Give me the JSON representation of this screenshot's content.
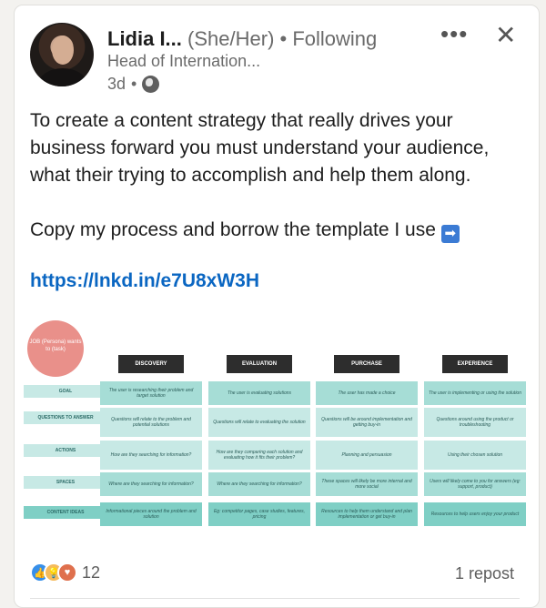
{
  "author": {
    "name": "Lidia I...",
    "pronouns": "(She/Her)",
    "separator": "•",
    "following": "Following",
    "headline": "Head of Internation...",
    "age": "3d",
    "visibility_icon": "globe-icon"
  },
  "actions": {
    "more_label": "•••",
    "close_label": "✕"
  },
  "post": {
    "paragraph1": "To create a content strategy that really drives your business forward you must understand your audience, what their trying to accomplish and help them along.",
    "paragraph2": "Copy my process and borrow the template I use",
    "arrow": "➡",
    "link": "https://lnkd.in/e7U8xW3H"
  },
  "template": {
    "job_circle": "JOB (Persona) wants to (task)",
    "stages": [
      "DISCOVERY",
      "EVALUATION",
      "PURCHASE",
      "EXPERIENCE"
    ],
    "rows": [
      {
        "label": "GOAL",
        "cells": [
          "The user is researching their problem and target solution",
          "The user is evaluating solutions",
          "The user has made a choice",
          "The user is implementing or using the solution"
        ]
      },
      {
        "label": "QUESTIONS TO ANSWER",
        "cells": [
          "Questions will relate to the problem and potential solutions",
          "Questions will relate to evaluating the solution",
          "Questions will be around implementation and getting buy-in",
          "Questions around using the product or troubleshooting"
        ]
      },
      {
        "label": "ACTIONS",
        "cells": [
          "How are they searching for information?",
          "How are they comparing each solution and evaluating how it fits their problem?",
          "Planning and persuasion",
          "Using their chosen solution"
        ]
      },
      {
        "label": "SPACES",
        "cells": [
          "Where are they searching for information?",
          "Where are they searching for information?",
          "These spaces will likely be more internal and more social",
          "Users will likely come to you for answers (eg: support, product)"
        ]
      },
      {
        "label": "CONTENT IDEAS",
        "cells": [
          "Informational pieces around the problem and solution",
          "Eg: competitor pages, case studies, features, pricing",
          "Resources to help them understand and plan implementation or get buy-in",
          "Resources to help users enjoy your product"
        ]
      }
    ],
    "colors": {
      "light": "#c7e9e5",
      "mid": "#a6ddd6",
      "dark": "#7fcfc5",
      "header": "#2d2d2d",
      "circle": "#e9908a"
    }
  },
  "footer": {
    "reaction_icons": [
      "like-icon",
      "insightful-icon",
      "love-icon"
    ],
    "reaction_count": "12",
    "repost_label": "1 repost"
  }
}
